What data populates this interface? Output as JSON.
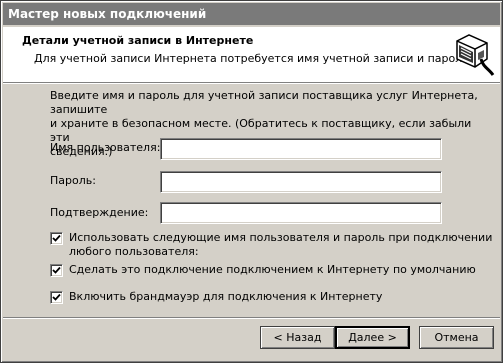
{
  "window": {
    "title": "Мастер новых подключений"
  },
  "header": {
    "title": "Детали учетной записи в Интернете",
    "subtitle": "Для учетной записи Интернета потребуется имя учетной записи и пароль.",
    "icon": "network-cable-icon"
  },
  "intro": {
    "line1": "Введите имя и пароль для учетной записи поставщика услуг Интернета, запишите",
    "line2": "и храните в безопасном месте. (Обратитесь к поставщику, если забыли эти",
    "line3": "сведения.)"
  },
  "fields": {
    "username": {
      "label": "Имя пользователя:",
      "value": ""
    },
    "password": {
      "label": "Пароль:",
      "value": ""
    },
    "confirm": {
      "label": "Подтверждение:",
      "value": ""
    }
  },
  "checkboxes": [
    {
      "label_line1": "Использовать следующие имя пользователя и пароль при подключении",
      "label_line2": "любого пользователя:",
      "checked": true
    },
    {
      "label_line1": "Сделать это подключение подключением к Интернету по умолчанию",
      "label_line2": "",
      "checked": true
    },
    {
      "label_line1": "Включить брандмауэр для подключения к Интернету",
      "label_line2": "",
      "checked": true
    }
  ],
  "buttons": {
    "back": "< Назад",
    "next": "Далее >",
    "cancel": "Отмена"
  }
}
